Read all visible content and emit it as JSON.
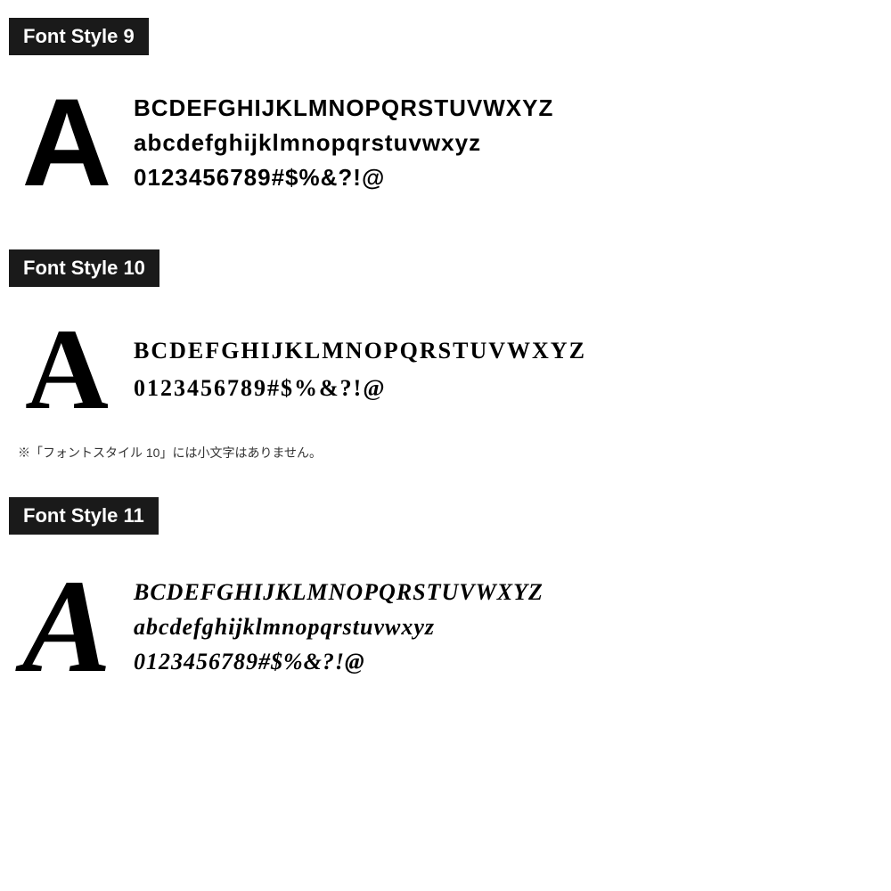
{
  "sections": [
    {
      "id": "font9",
      "title": "Font Style 9",
      "big_letter": "A",
      "lines": [
        "BCDEFGHIJKLMNOPQRSTUVWXYZ",
        "abcdefghijklmnopqrstuvwxyz",
        "0123456789#$%&?!@"
      ],
      "note": null
    },
    {
      "id": "font10",
      "title": "Font Style 10",
      "big_letter": "A",
      "lines": [
        "BCDEFGHIJKLMNOPQRSTUVWXYZ",
        "0123456789#$%&?!@"
      ],
      "note": "※「フォントスタイル 10」には小文字はありません。"
    },
    {
      "id": "font11",
      "title": "Font Style 11",
      "big_letter": "A",
      "lines": [
        "BCDEFGHIJKLMNOPQRSTUVWXYZ",
        "abcdefghijklmnopqrstuvwxyz",
        "0123456789#$%&?!@"
      ],
      "note": null
    }
  ]
}
